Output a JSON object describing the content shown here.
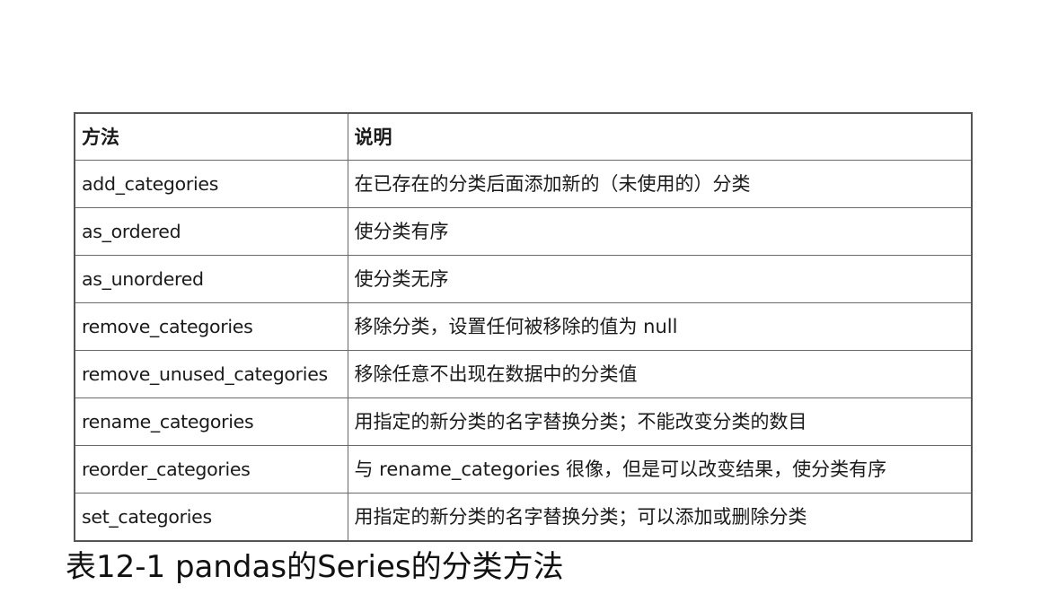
{
  "table": {
    "headers": [
      "方法",
      "说明"
    ],
    "rows": [
      [
        "add_categories",
        "在已存在的分类后面添加新的（未使用的）分类"
      ],
      [
        "as_ordered",
        "使分类有序"
      ],
      [
        "as_unordered",
        "使分类无序"
      ],
      [
        "remove_categories",
        "移除分类，设置任何被移除的值为 null"
      ],
      [
        "remove_unused_categories",
        "移除任意不出现在数据中的分类值"
      ],
      [
        "rename_categories",
        "用指定的新分类的名字替换分类；不能改变分类的数目"
      ],
      [
        "reorder_categories",
        "与 rename_categories 很像，但是可以改变结果，使分类有序"
      ],
      [
        "set_categories",
        "用指定的新分类的名字替换分类；可以添加或删除分类"
      ]
    ]
  },
  "caption": "表12-1 pandas的Series的分类方法"
}
